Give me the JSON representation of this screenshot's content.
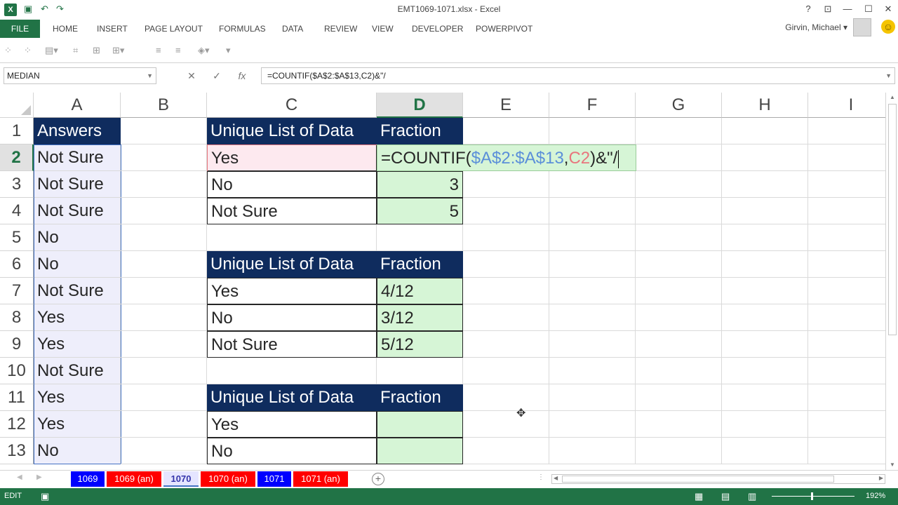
{
  "window": {
    "title": "EMT1069-1071.xlsx - Excel",
    "app_icon": "X",
    "qat_icons": [
      "save-icon",
      "undo-icon",
      "redo-icon"
    ],
    "help": "?",
    "ribbon_display": "⊡",
    "minimize": "—",
    "maximize": "☐",
    "close": "✕"
  },
  "ribbon": {
    "file": "FILE",
    "tabs": [
      "HOME",
      "INSERT",
      "PAGE LAYOUT",
      "FORMULAS",
      "DATA",
      "REVIEW",
      "VIEW",
      "DEVELOPER",
      "POWERPIVOT"
    ],
    "user": "Girvin, Michael",
    "user_caret": "▾"
  },
  "formula_bar": {
    "name_box": "MEDIAN",
    "cancel": "✕",
    "enter": "✓",
    "fx": "fx",
    "formula": "=COUNTIF($A$2:$A$13,C2)&\"/"
  },
  "columns": [
    "A",
    "B",
    "C",
    "D",
    "E",
    "F",
    "G",
    "H",
    "I"
  ],
  "rows": [
    "1",
    "2",
    "3",
    "4",
    "5",
    "6",
    "7",
    "8",
    "9",
    "10",
    "11",
    "12",
    "13"
  ],
  "cells": {
    "A1": "Answers",
    "A2": "Not Sure",
    "A3": "Not Sure",
    "A4": "Not Sure",
    "A5": "No",
    "A6": "No",
    "A7": "Not Sure",
    "A8": "Yes",
    "A9": "Yes",
    "A10": "Not Sure",
    "A11": "Yes",
    "A12": "Yes",
    "A13": "No",
    "C1": "Unique List of Data",
    "D1": "Fraction",
    "C2": "Yes",
    "C3": "No",
    "C4": "Not Sure",
    "D3": "3",
    "D4": "5",
    "C6": "Unique List of Data",
    "D6": "Fraction",
    "C7": "Yes",
    "D7": "4/12",
    "C8": "No",
    "D8": "3/12",
    "C9": "Not Sure",
    "D9": "5/12",
    "C11": "Unique List of Data",
    "D11": "Fraction",
    "C12": "Yes",
    "C13": "No"
  },
  "edit_cell": {
    "prefix": "=COUNTIF(",
    "range_ref": "$A$2:$A$13",
    "comma": ",",
    "cell_ref": "C2",
    "suffix": ")&\"/"
  },
  "sheets": [
    {
      "name": "1069",
      "color": "blue"
    },
    {
      "name": "1069 (an)",
      "color": "red"
    },
    {
      "name": "1070",
      "color": "active"
    },
    {
      "name": "1070 (an)",
      "color": "red"
    },
    {
      "name": "1071",
      "color": "blue"
    },
    {
      "name": "1071 (an)",
      "color": "red"
    }
  ],
  "status": {
    "mode": "EDIT",
    "zoom": "192%"
  }
}
